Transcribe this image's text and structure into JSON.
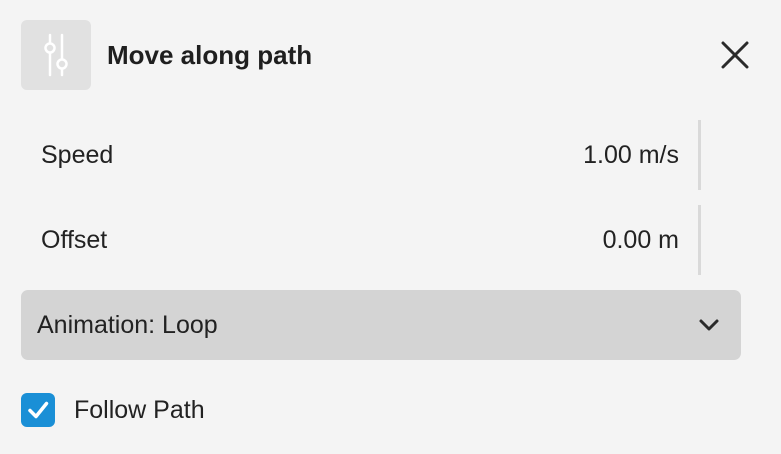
{
  "panel": {
    "title": "Move along path",
    "icon": "sliders-icon",
    "close_icon": "close-icon"
  },
  "fields": {
    "speed": {
      "label": "Speed",
      "value": "1.00 m/s"
    },
    "offset": {
      "label": "Offset",
      "value": "0.00 m"
    }
  },
  "animation": {
    "label": "Animation: Loop",
    "icon": "chevron-down-icon"
  },
  "follow_path": {
    "label": "Follow Path",
    "checked": true
  },
  "colors": {
    "background": "#f4f4f4",
    "checkbox_accent": "#1a8fd6",
    "dropdown_bg": "#d4d4d4"
  }
}
